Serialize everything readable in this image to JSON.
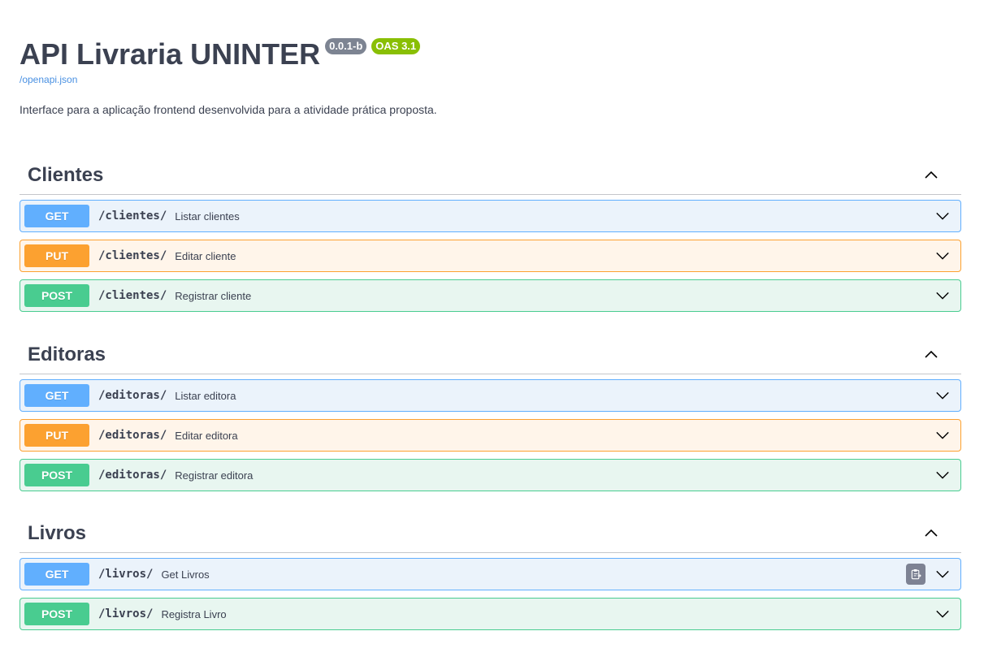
{
  "info": {
    "title": "API Livraria UNINTER",
    "version": "0.0.1-b",
    "oas": "OAS 3.1",
    "spec_link": "/openapi.json",
    "description": "Interface para a aplicação frontend desenvolvida para a atividade prática proposta."
  },
  "tags": [
    {
      "name": "Clientes",
      "operations": [
        {
          "method": "GET",
          "path": "/clientes/",
          "summary": "Listar clientes"
        },
        {
          "method": "PUT",
          "path": "/clientes/",
          "summary": "Editar cliente"
        },
        {
          "method": "POST",
          "path": "/clientes/",
          "summary": "Registrar cliente"
        }
      ]
    },
    {
      "name": "Editoras",
      "operations": [
        {
          "method": "GET",
          "path": "/editoras/",
          "summary": "Listar editora"
        },
        {
          "method": "PUT",
          "path": "/editoras/",
          "summary": "Editar editora"
        },
        {
          "method": "POST",
          "path": "/editoras/",
          "summary": "Registrar editora"
        }
      ]
    },
    {
      "name": "Livros",
      "operations": [
        {
          "method": "GET",
          "path": "/livros/",
          "summary": "Get Livros"
        },
        {
          "method": "POST",
          "path": "/livros/",
          "summary": "Registra Livro"
        }
      ]
    }
  ],
  "colors": {
    "get": "#61affe",
    "put": "#fca130",
    "post": "#49cc90",
    "version_badge": "#7d8492",
    "oas_badge": "#89bf04",
    "link": "#4990e2"
  },
  "icons": {
    "tag_toggle": "chevron-up-icon",
    "op_toggle": "chevron-down-icon",
    "copy": "clipboard-copy-icon"
  }
}
